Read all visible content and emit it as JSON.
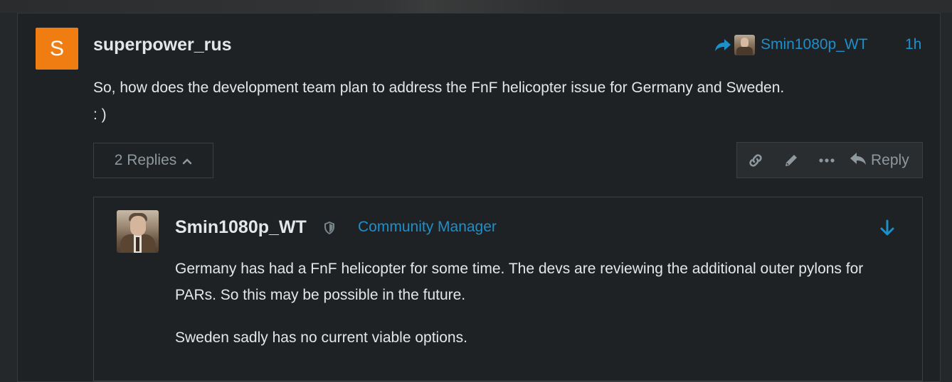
{
  "post": {
    "avatar_letter": "S",
    "author": "superpower_rus",
    "reply_to_name": "Smin1080p_WT",
    "time": "1h",
    "body_line_1": "So, how does the development team plan to address the FnF helicopter issue for Germany and Sweden.",
    "body_line_2": ": )",
    "replies_label": "2 Replies",
    "actions": {
      "reply_label": "Reply"
    }
  },
  "reply": {
    "author": "Smin1080p_WT",
    "title": "Community Manager",
    "paragraph_1": "Germany has had a FnF helicopter for some time. The devs are reviewing the additional outer pylons for PARs. So this may be possible in the future.",
    "paragraph_2": "Sweden sadly has no current viable options."
  },
  "colors": {
    "accent": "#1d8fcb",
    "avatar_bg": "#f07d12",
    "text": "#e4e6e7",
    "muted": "#8e989f"
  }
}
